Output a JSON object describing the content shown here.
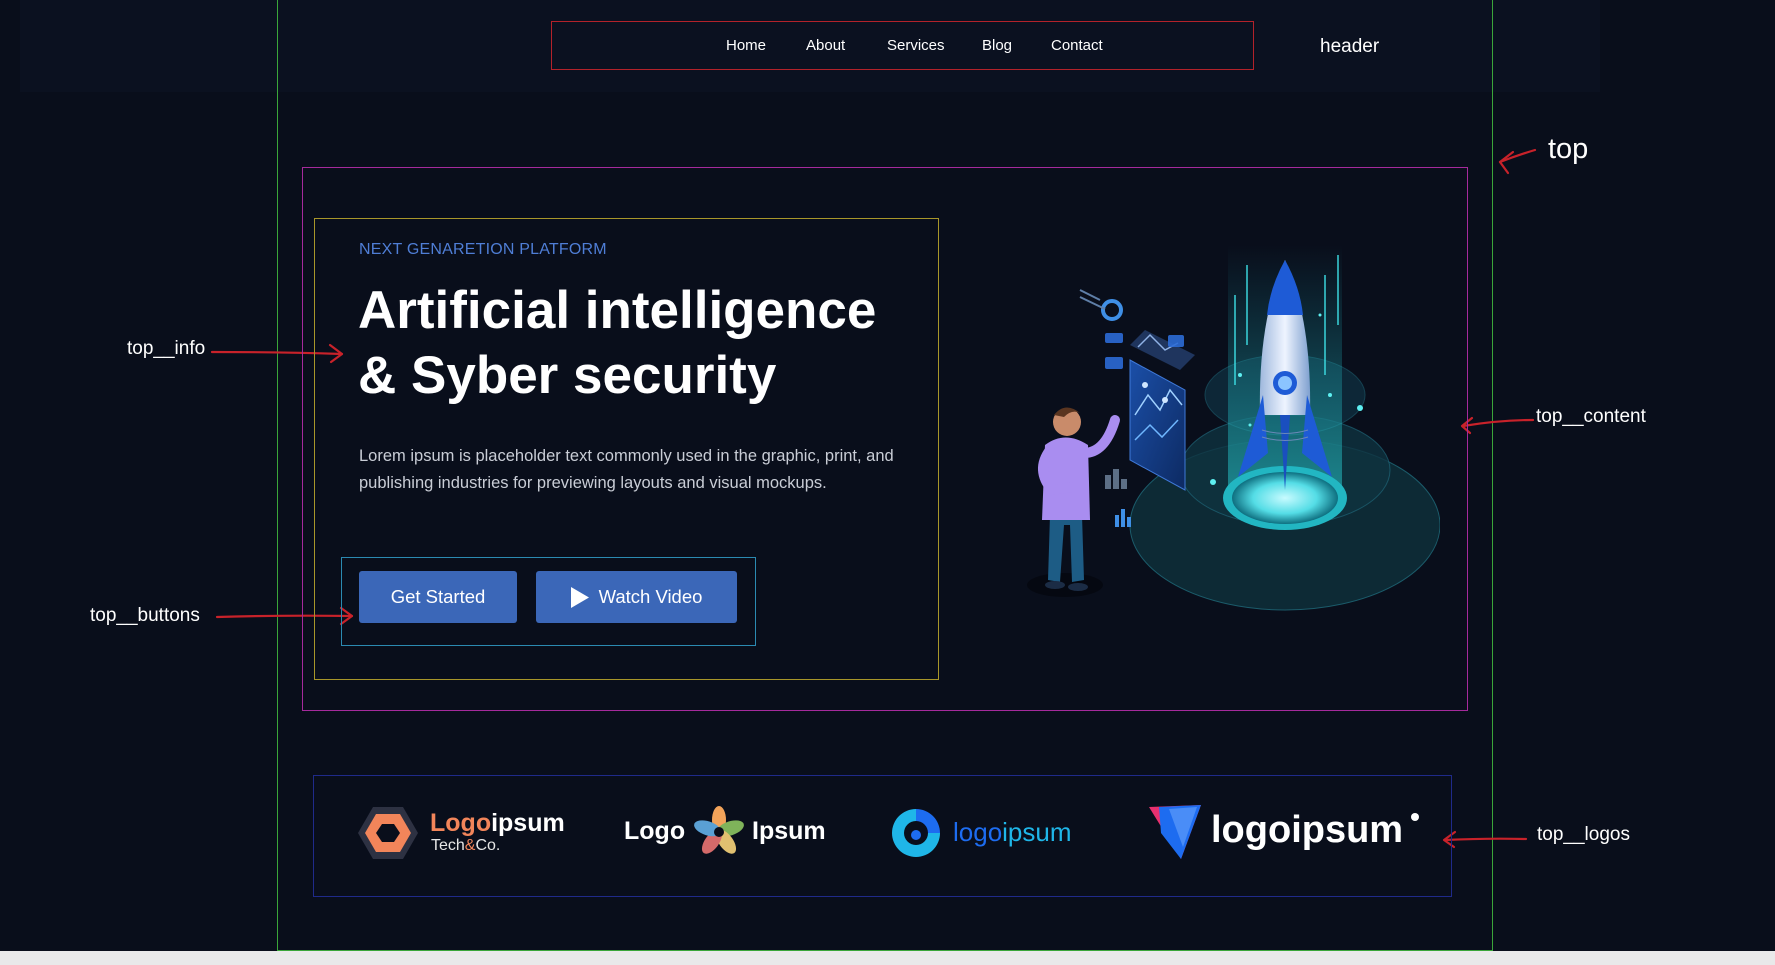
{
  "header": {
    "nav": [
      "Home",
      "About",
      "Services",
      "Blog",
      "Contact"
    ]
  },
  "annotations": {
    "header": "header",
    "top": "top",
    "top_info": "top__info",
    "top_buttons": "top__buttons",
    "top_content": "top__content",
    "top_logos": "top__logos"
  },
  "hero": {
    "eyebrow": "NEXT GENARETION PLATFORM",
    "title_line1": "Artificial intelligence",
    "title_line2": "& Syber security",
    "description": "Lorem ipsum is placeholder text commonly used in the graphic, print, and publishing industries for previewing layouts and visual mockups.",
    "primary_button": "Get Started",
    "secondary_button": "Watch Video"
  },
  "logos": [
    {
      "part1": "Logo",
      "part2": "ipsum",
      "sub1": "Tech",
      "sub_amp": "&",
      "sub2": "Co."
    },
    {
      "left": "Logo",
      "right": "Ipsum"
    },
    {
      "part1": "logo",
      "part2": "ipsum"
    },
    {
      "text": "logoipsum"
    }
  ],
  "icons": [
    "play-icon",
    "rocket-illustration"
  ],
  "colors": {
    "background": "#090e1b",
    "accent": "#3b67b8",
    "eyebrow": "#4f7ed6",
    "annotation_arrow": "#c8222a",
    "logo_orange": "#f2855a",
    "logo_blue": "#1d6cf0",
    "logo_cyan": "#1fb6e8"
  }
}
